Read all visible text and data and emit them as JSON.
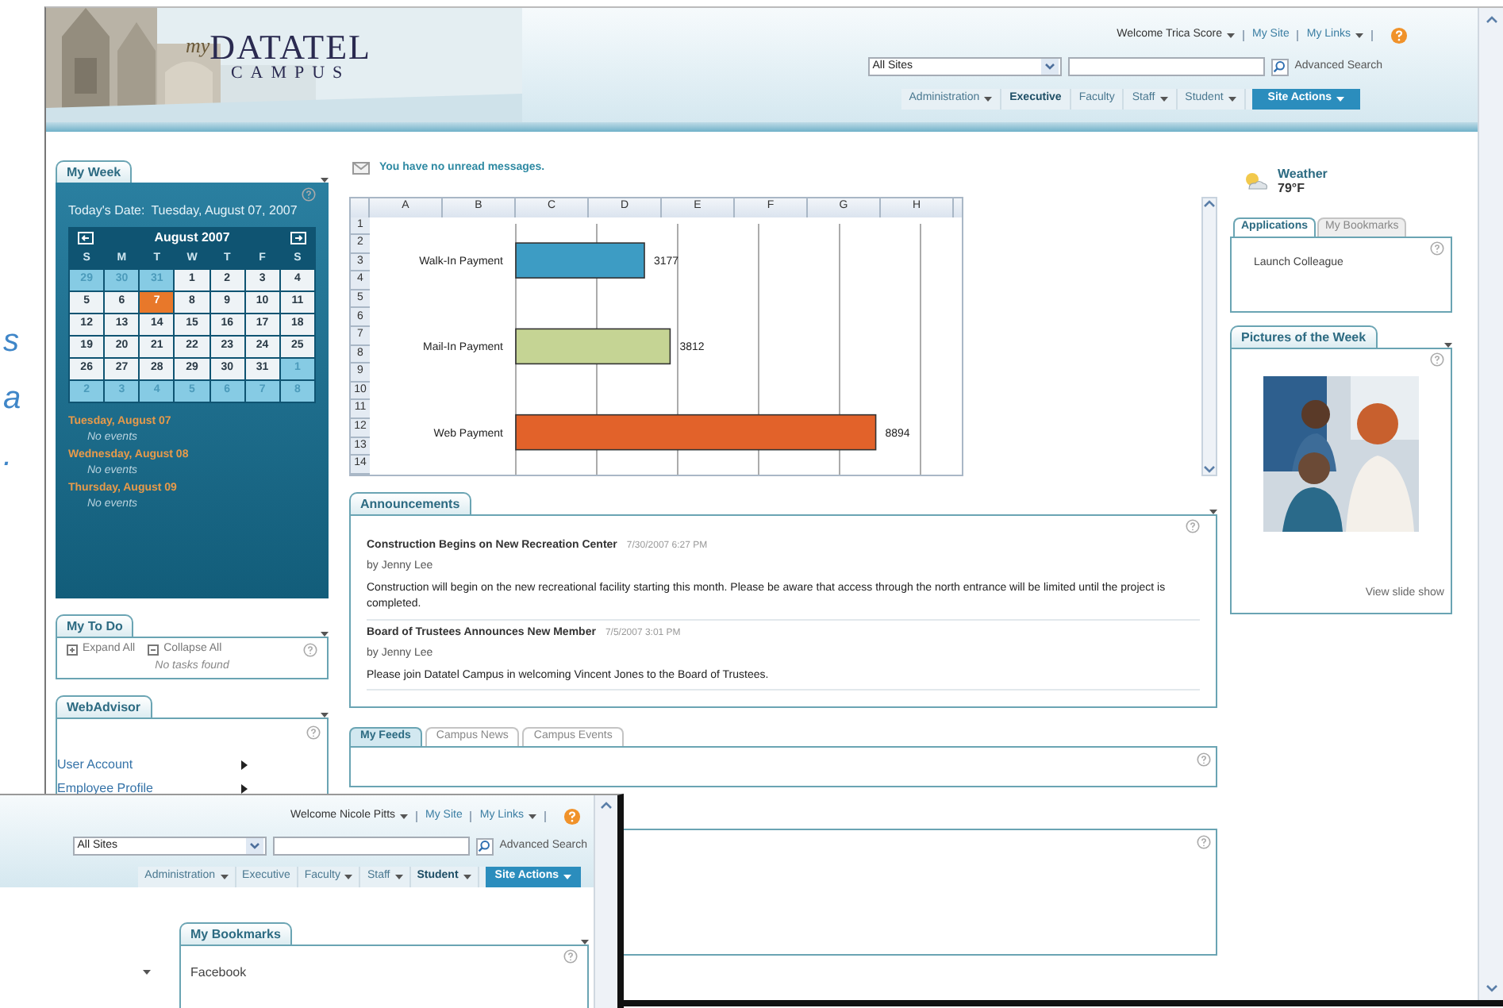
{
  "background_text": [
    "s",
    "a",
    "."
  ],
  "main_window": {
    "logo": {
      "prefix": "my",
      "name": "DATATEL",
      "sub": "CAMPUS"
    },
    "user_links": [
      {
        "label": "Welcome Trica Score",
        "dropdown": true
      },
      {
        "label": "My Site",
        "dropdown": false
      },
      {
        "label": "My Links",
        "dropdown": true
      }
    ],
    "scope": "All Sites",
    "advanced_search": "Advanced Search",
    "nav": [
      {
        "label": "Administration",
        "dropdown": true,
        "selected": false,
        "kind": "tab"
      },
      {
        "label": "Executive",
        "dropdown": false,
        "selected": true,
        "kind": "tab"
      },
      {
        "label": "Faculty",
        "dropdown": false,
        "selected": false,
        "kind": "tab"
      },
      {
        "label": "Staff",
        "dropdown": true,
        "selected": false,
        "kind": "tab"
      },
      {
        "label": "Student",
        "dropdown": true,
        "selected": false,
        "kind": "tab"
      },
      {
        "label": "Site Actions",
        "dropdown": true,
        "selected": false,
        "kind": "action"
      }
    ],
    "my_week": {
      "title": "My Week",
      "today_label": "Today's Date:",
      "today_value": "Tuesday, August 07, 2007",
      "month": "August 2007",
      "weekdays": [
        "S",
        "M",
        "T",
        "W",
        "T",
        "F",
        "S"
      ],
      "days": [
        {
          "label": "29",
          "kind": "adjacent",
          "selected": false
        },
        {
          "label": "30",
          "kind": "adjacent",
          "selected": false
        },
        {
          "label": "31",
          "kind": "adjacent",
          "selected": false
        },
        {
          "label": "1",
          "kind": "current",
          "selected": false
        },
        {
          "label": "2",
          "kind": "current",
          "selected": false
        },
        {
          "label": "3",
          "kind": "current",
          "selected": false
        },
        {
          "label": "4",
          "kind": "current",
          "selected": false
        },
        {
          "label": "5",
          "kind": "current",
          "selected": false
        },
        {
          "label": "6",
          "kind": "current",
          "selected": false
        },
        {
          "label": "7",
          "kind": "current",
          "selected": true
        },
        {
          "label": "8",
          "kind": "current",
          "selected": false
        },
        {
          "label": "9",
          "kind": "current",
          "selected": false
        },
        {
          "label": "10",
          "kind": "current",
          "selected": false
        },
        {
          "label": "11",
          "kind": "current",
          "selected": false
        },
        {
          "label": "12",
          "kind": "current",
          "selected": false
        },
        {
          "label": "13",
          "kind": "current",
          "selected": false
        },
        {
          "label": "14",
          "kind": "current",
          "selected": false
        },
        {
          "label": "15",
          "kind": "current",
          "selected": false
        },
        {
          "label": "16",
          "kind": "current",
          "selected": false
        },
        {
          "label": "17",
          "kind": "current",
          "selected": false
        },
        {
          "label": "18",
          "kind": "current",
          "selected": false
        },
        {
          "label": "19",
          "kind": "current",
          "selected": false
        },
        {
          "label": "20",
          "kind": "current",
          "selected": false
        },
        {
          "label": "21",
          "kind": "current",
          "selected": false
        },
        {
          "label": "22",
          "kind": "current",
          "selected": false
        },
        {
          "label": "23",
          "kind": "current",
          "selected": false
        },
        {
          "label": "24",
          "kind": "current",
          "selected": false
        },
        {
          "label": "25",
          "kind": "current",
          "selected": false
        },
        {
          "label": "26",
          "kind": "current",
          "selected": false
        },
        {
          "label": "27",
          "kind": "current",
          "selected": false
        },
        {
          "label": "28",
          "kind": "current",
          "selected": false
        },
        {
          "label": "29",
          "kind": "current",
          "selected": false
        },
        {
          "label": "30",
          "kind": "current",
          "selected": false
        },
        {
          "label": "31",
          "kind": "current",
          "selected": false
        },
        {
          "label": "1",
          "kind": "adjacent",
          "selected": false
        },
        {
          "label": "2",
          "kind": "adjacent",
          "selected": false
        },
        {
          "label": "3",
          "kind": "adjacent",
          "selected": false
        },
        {
          "label": "4",
          "kind": "adjacent",
          "selected": false
        },
        {
          "label": "5",
          "kind": "adjacent",
          "selected": false
        },
        {
          "label": "6",
          "kind": "adjacent",
          "selected": false
        },
        {
          "label": "7",
          "kind": "adjacent",
          "selected": false
        },
        {
          "label": "8",
          "kind": "adjacent",
          "selected": false
        }
      ],
      "events": [
        {
          "day": "Tuesday, August 07",
          "note": "No events"
        },
        {
          "day": "Wednesday, August 08",
          "note": "No events"
        },
        {
          "day": "Thursday, August 09",
          "note": "No events"
        }
      ]
    },
    "todo": {
      "title": "My To Do",
      "expand": "Expand All",
      "collapse": "Collapse All",
      "empty": "No tasks found"
    },
    "webadvisor": {
      "title": "WebAdvisor",
      "links": [
        "User Account",
        "Employee Profile"
      ]
    },
    "messages": "You have no unread messages.",
    "sheet": {
      "columns": [
        "A",
        "B",
        "C",
        "D",
        "E",
        "F",
        "G",
        "H"
      ],
      "rows": [
        "1",
        "2",
        "3",
        "4",
        "5",
        "6",
        "7",
        "8",
        "9",
        "10",
        "11",
        "12",
        "13",
        "14"
      ],
      "chart_data": {
        "type": "bar",
        "orientation": "horizontal",
        "categories": [
          "Walk-In Payment",
          "Mail-In Payment",
          "Web Payment"
        ],
        "values": [
          3177,
          3812,
          8894
        ],
        "colors": [
          "#3d9cc4",
          "#c5d494",
          "#e2622a"
        ],
        "data_labels": true
      }
    },
    "announcements": {
      "title": "Announcements",
      "items": [
        {
          "title": "Construction Begins on New Recreation Center",
          "date": "7/30/2007 6:27 PM",
          "author": "by Jenny Lee",
          "body": "Construction will begin on the new recreational facility starting this month.  Please be aware that access through the north entrance will be limited until the project is completed."
        },
        {
          "title": "Board of Trustees Announces New Member",
          "date": "7/5/2007 3:01 PM",
          "author": "by Jenny Lee",
          "body": "Please join Datatel Campus in welcoming Vincent Jones to the Board of Trustees."
        }
      ]
    },
    "feed_tabs": [
      {
        "label": "My Feeds",
        "selected": true
      },
      {
        "label": "Campus News",
        "selected": false
      },
      {
        "label": "Campus Events",
        "selected": false
      }
    ],
    "weather": {
      "label": "Weather",
      "temperature": "79°F"
    },
    "side_tabs": [
      {
        "label": "Applications",
        "selected": true
      },
      {
        "label": "My Bookmarks",
        "selected": false
      }
    ],
    "apps": [
      "Launch Colleague"
    ],
    "pictures": {
      "title": "Pictures of the Week",
      "link": "View slide show"
    }
  },
  "overlay_window": {
    "user_links": [
      {
        "label": "Welcome Nicole Pitts",
        "dropdown": true
      },
      {
        "label": "My Site",
        "dropdown": false
      },
      {
        "label": "My Links",
        "dropdown": true
      }
    ],
    "scope": "All Sites",
    "advanced_search": "Advanced Search",
    "nav": [
      {
        "label": "Administration",
        "dropdown": true,
        "selected": false,
        "kind": "tab"
      },
      {
        "label": "Executive",
        "dropdown": false,
        "selected": false,
        "kind": "tab"
      },
      {
        "label": "Faculty",
        "dropdown": true,
        "selected": false,
        "kind": "tab"
      },
      {
        "label": "Staff",
        "dropdown": true,
        "selected": false,
        "kind": "tab"
      },
      {
        "label": "Student",
        "dropdown": true,
        "selected": true,
        "kind": "tab"
      },
      {
        "label": "Site Actions",
        "dropdown": true,
        "selected": false,
        "kind": "action"
      }
    ],
    "bookmarks": {
      "title": "My Bookmarks",
      "links": [
        "Facebook"
      ]
    }
  }
}
